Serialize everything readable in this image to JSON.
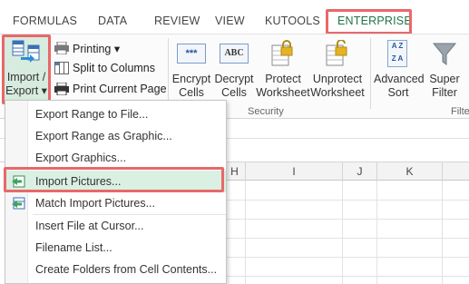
{
  "tabs": [
    {
      "label": "FORMULAS"
    },
    {
      "label": "DATA"
    },
    {
      "label": "REVIEW"
    },
    {
      "label": "VIEW"
    },
    {
      "label": "KUTOOLS"
    },
    {
      "label": "ENTERPRISE"
    }
  ],
  "ribbon": {
    "import_export": {
      "line1": "Import /",
      "line2": "Export ▾"
    },
    "printing": "Printing ▾",
    "split_to_columns": "Split to Columns",
    "print_current_page": "Print Current Page",
    "encrypt": {
      "line1": "Encrypt",
      "line2": "Cells"
    },
    "decrypt": {
      "line1": "Decrypt",
      "line2": "Cells"
    },
    "protect": {
      "line1": "Protect",
      "line2": "Worksheet"
    },
    "unprotect": {
      "line1": "Unprotect",
      "line2": "Worksheet"
    },
    "advanced_sort": {
      "line1": "Advanced",
      "line2": "Sort"
    },
    "super_filter": {
      "line1": "Super",
      "line2": "Filter"
    },
    "group_security": "Security",
    "group_filter_partial": "Filte",
    "encrypt_icon_text": "***",
    "decrypt_icon_text": "ABC",
    "sort_icon_text_top": "A Z",
    "sort_icon_text_bottom": "Z A"
  },
  "columns": [
    "H",
    "I",
    "J",
    "K"
  ],
  "menu": {
    "items": [
      {
        "label": "Export Range to File..."
      },
      {
        "label": "Export Range as Graphic..."
      },
      {
        "label": "Export Graphics..."
      },
      {
        "label": "Import Pictures..."
      },
      {
        "label": "Match Import Pictures..."
      },
      {
        "label": "Insert File at Cursor..."
      },
      {
        "label": "Filename List..."
      },
      {
        "label": "Create Folders from Cell Contents..."
      }
    ]
  },
  "colors": {
    "accent": "#217346",
    "highlight": "#e8686a",
    "active_row": "#daf0e2"
  }
}
